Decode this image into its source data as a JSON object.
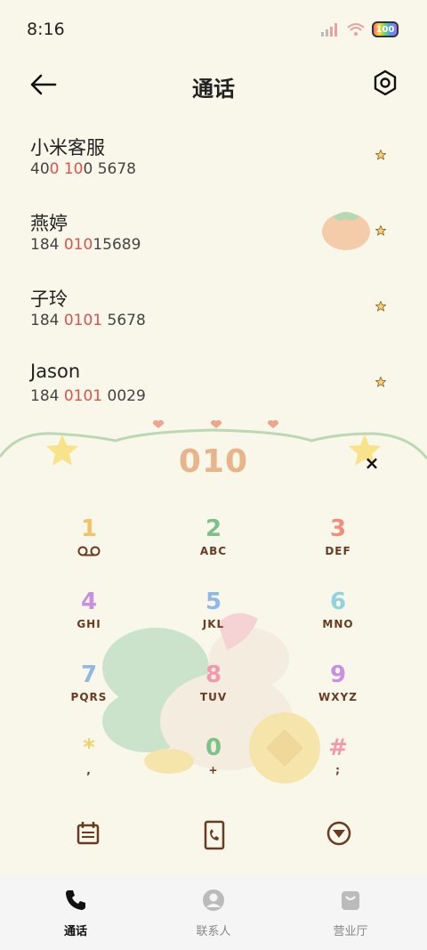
{
  "status": {
    "time": "8:16",
    "battery": "100"
  },
  "header": {
    "title": "通话"
  },
  "contacts": [
    {
      "name": "小米客服",
      "number_parts": [
        "40",
        "0 10",
        "0 5678"
      ]
    },
    {
      "name": "燕婷",
      "number_parts": [
        "184 ",
        "010",
        "15689"
      ]
    },
    {
      "name": "子玲",
      "number_parts": [
        "184 ",
        "0101",
        " 5678"
      ]
    },
    {
      "name": "Jason",
      "number_parts": [
        "184 ",
        "0101",
        " 0029"
      ]
    }
  ],
  "dialer": {
    "input": "010",
    "clear_symbol": "×"
  },
  "keys": [
    {
      "num": "1",
      "letters": "",
      "color": "#f1c36a"
    },
    {
      "num": "2",
      "letters": "ABC",
      "color": "#7cc08a"
    },
    {
      "num": "3",
      "letters": "DEF",
      "color": "#ef8e7a"
    },
    {
      "num": "4",
      "letters": "GHI",
      "color": "#c98fe0"
    },
    {
      "num": "5",
      "letters": "JKL",
      "color": "#8fb7e8"
    },
    {
      "num": "6",
      "letters": "MNO",
      "color": "#8fd4e0"
    },
    {
      "num": "7",
      "letters": "PQRS",
      "color": "#8fb7e8"
    },
    {
      "num": "8",
      "letters": "TUV",
      "color": "#f09ab0"
    },
    {
      "num": "9",
      "letters": "WXYZ",
      "color": "#c98fe0"
    },
    {
      "num": "*",
      "letters": ",",
      "color": "#f1d36a"
    },
    {
      "num": "0",
      "letters": "+",
      "color": "#7cc08a"
    },
    {
      "num": "#",
      "letters": ";",
      "color": "#f09ab0"
    }
  ],
  "tabs": [
    {
      "label": "通话",
      "icon": "phone-icon",
      "active": true
    },
    {
      "label": "联系人",
      "icon": "contact-icon",
      "active": false
    },
    {
      "label": "营业厅",
      "icon": "store-icon",
      "active": false
    }
  ],
  "colors": {
    "background": "#f8f7e9",
    "highlight": "#d9534f",
    "accent_brown": "#6b3a22",
    "wave": "#bcd8b2"
  }
}
